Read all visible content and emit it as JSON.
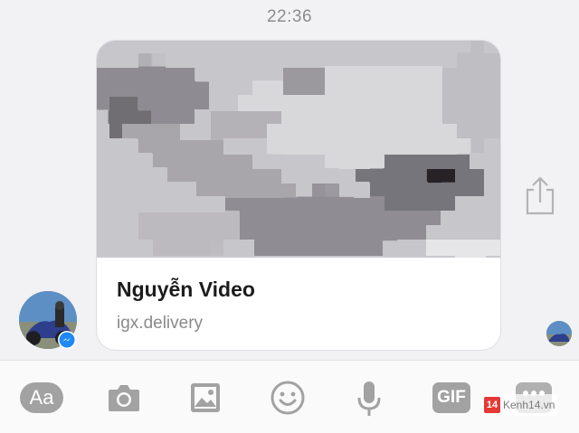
{
  "chat": {
    "timestamp": "22:36"
  },
  "link_card": {
    "title": "Nguyễn Video",
    "domain": "igx.delivery"
  },
  "toolbar": {
    "text_format_label": "Aa",
    "gif_label": "GIF"
  },
  "watermark": {
    "logo": "14",
    "text": "Kenh14.vn"
  },
  "icons": {
    "share": "share-icon",
    "camera": "camera-icon",
    "image": "image-icon",
    "emoji": "emoji-icon",
    "microphone": "microphone-icon",
    "more": "more-icon",
    "messenger": "messenger-icon"
  },
  "colors": {
    "icon_gray": "#a2a2a2",
    "messenger_blue": "#1e88f5",
    "background": "#f2f2f4"
  }
}
